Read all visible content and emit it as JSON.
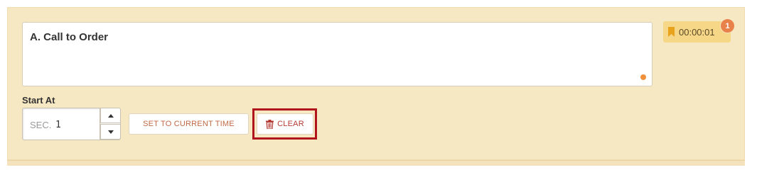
{
  "agenda_item": {
    "title": "A. Call to Order"
  },
  "timestamp": {
    "time": "00:00:01",
    "badge_count": "1",
    "icon": "bookmark-icon"
  },
  "start_at": {
    "label": "Start At",
    "unit_prefix": "SEC.",
    "value": "1",
    "stepper_icons": [
      "caret-up-icon",
      "caret-down-icon"
    ]
  },
  "actions": {
    "set_current_time_label": "SET TO CURRENT TIME",
    "clear_label": "CLEAR",
    "clear_icon": "trash-icon"
  },
  "colors": {
    "panel_bg": "#f7e8c4",
    "chip_bg": "#f6d687",
    "badge": "#e9824a",
    "highlight": "#b0151e"
  }
}
